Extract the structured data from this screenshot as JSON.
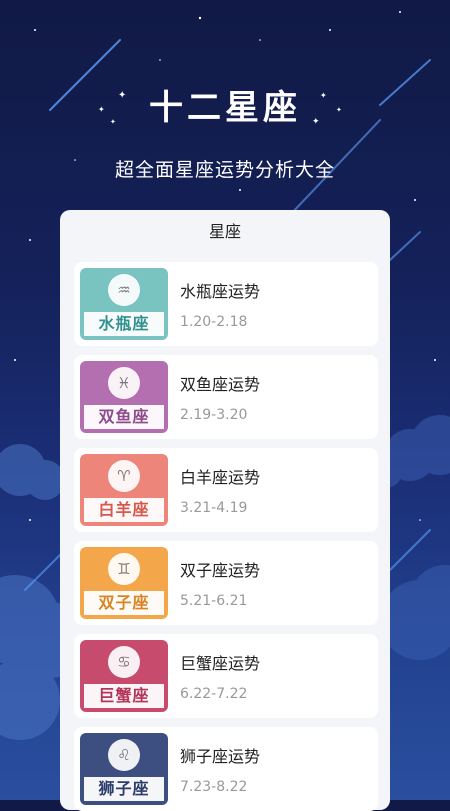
{
  "header": {
    "title": "十二星座",
    "subtitle": "超全面星座运势分析大全"
  },
  "panel": {
    "title": "星座"
  },
  "colors": {
    "background_top": "#111a45",
    "background_bottom": "#2a4f9e",
    "card": "#f4f5f8"
  },
  "signs": [
    {
      "label": "水瓶座",
      "name": "水瓶座运势",
      "date": "1.20-2.18",
      "color": "#79c3c1",
      "text_color": "#2f8f8c",
      "icon": "aquarius-icon",
      "glyph": "♒"
    },
    {
      "label": "双鱼座",
      "name": "双鱼座运势",
      "date": "2.19-3.20",
      "color": "#b36fb0",
      "text_color": "#8e4a8b",
      "icon": "pisces-icon",
      "glyph": "♓"
    },
    {
      "label": "白羊座",
      "name": "白羊座运势",
      "date": "3.21-4.19",
      "color": "#ee857a",
      "text_color": "#d4574b",
      "icon": "aries-icon",
      "glyph": "♈"
    },
    {
      "label": "双子座",
      "name": "双子座运势",
      "date": "5.21-6.21",
      "color": "#f4a74a",
      "text_color": "#d98322",
      "icon": "gemini-icon",
      "glyph": "♊"
    },
    {
      "label": "巨蟹座",
      "name": "巨蟹座运势",
      "date": "6.22-7.22",
      "color": "#c74b6d",
      "text_color": "#b23458",
      "icon": "cancer-icon",
      "glyph": "♋"
    },
    {
      "label": "狮子座",
      "name": "狮子座运势",
      "date": "7.23-8.22",
      "color": "#3d4f80",
      "text_color": "#2c3d6b",
      "icon": "leo-icon",
      "glyph": "♌"
    }
  ]
}
